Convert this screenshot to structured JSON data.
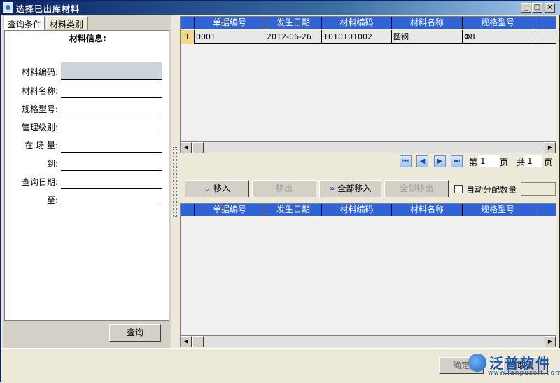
{
  "window": {
    "title": "选择已出库材料",
    "min": "_",
    "max": "□",
    "close": "×"
  },
  "tabs": [
    "查询条件",
    "材料类别"
  ],
  "form": {
    "title": "材料信息:",
    "labels": [
      "材料编码:",
      "材料名称:",
      "规格型号:",
      "管理级别:",
      "在 场 量:",
      "到:",
      "查询日期:",
      "至:"
    ],
    "query_button": "查询"
  },
  "top_grid": {
    "columns": [
      "单据编号",
      "发生日期",
      "材料编码",
      "材料名称",
      "规格型号"
    ],
    "rows": [
      {
        "num": "1",
        "cells": [
          "0001",
          "2012-06-26",
          "1010101002",
          "圆钢",
          "Φ8"
        ]
      }
    ]
  },
  "pager": {
    "page_label": "第",
    "page_value": "1",
    "page_unit": "页",
    "total_label": "共",
    "total_value": "1",
    "total_unit": "页"
  },
  "toolbar": {
    "move_in": "移入",
    "move_out": "移出",
    "move_all_in": "全部移入",
    "move_all_out": "全部移出",
    "auto_alloc": "自动分配数量"
  },
  "bottom_grid": {
    "columns": [
      "单据编号",
      "发生日期",
      "材料编码",
      "材料名称",
      "规格型号"
    ]
  },
  "footer": {
    "ok": "确定",
    "cancel": "取消",
    "logo_text": "泛普软件",
    "logo_url": "www.fanpusoft.com"
  }
}
